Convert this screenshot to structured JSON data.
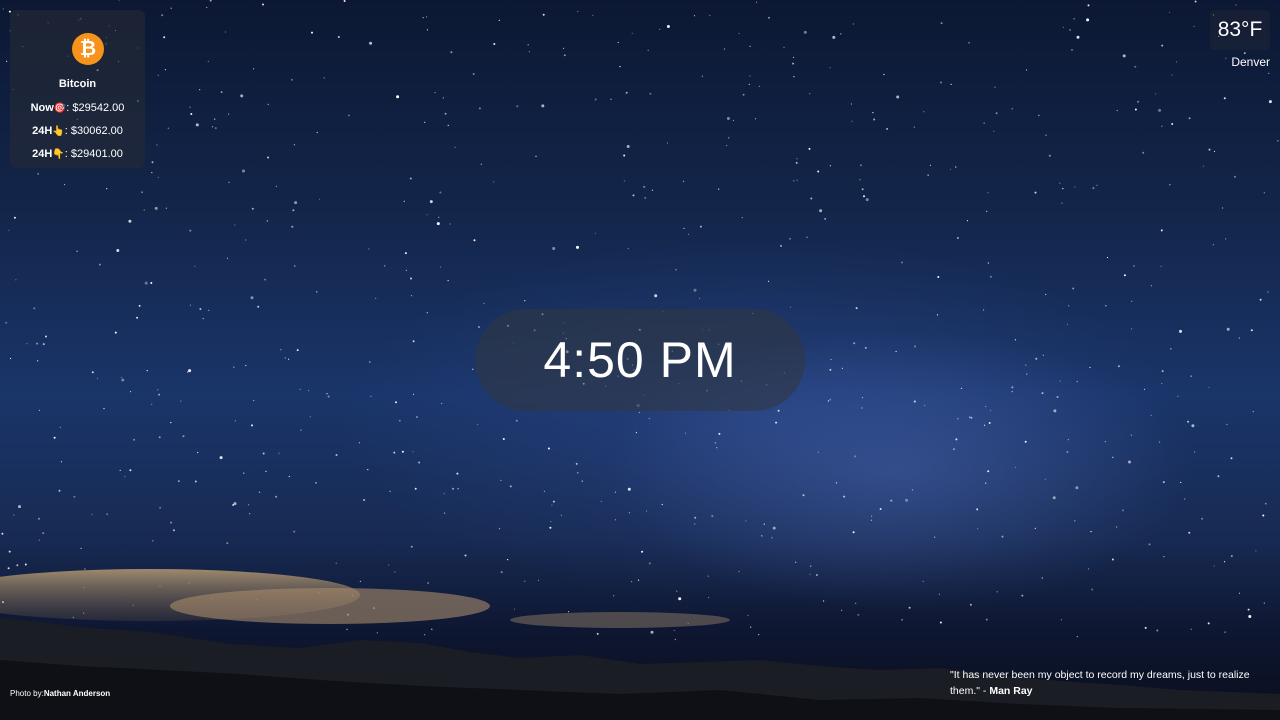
{
  "background": {
    "accent_color": "#1a356a"
  },
  "crypto": {
    "name": "Bitcoin",
    "logo_symbol": "₿",
    "logo_color": "#f7931a",
    "rows": [
      {
        "label": "Now",
        "emoji": "🎯",
        "value": ": $29542.00"
      },
      {
        "label": "24H",
        "emoji": "👆",
        "value": ": $30062.00"
      },
      {
        "label": "24H",
        "emoji": "👇",
        "value": ": $29401.00"
      }
    ]
  },
  "weather": {
    "temperature": "83°F",
    "city": "Denver"
  },
  "clock": {
    "time": "4:50 PM"
  },
  "quote": {
    "text": "\"It has never been my object to record my dreams, just to realize them.\" - ",
    "author": "Man Ray"
  },
  "credit": {
    "prefix": "Photo by:",
    "photographer": "Nathan Anderson"
  }
}
